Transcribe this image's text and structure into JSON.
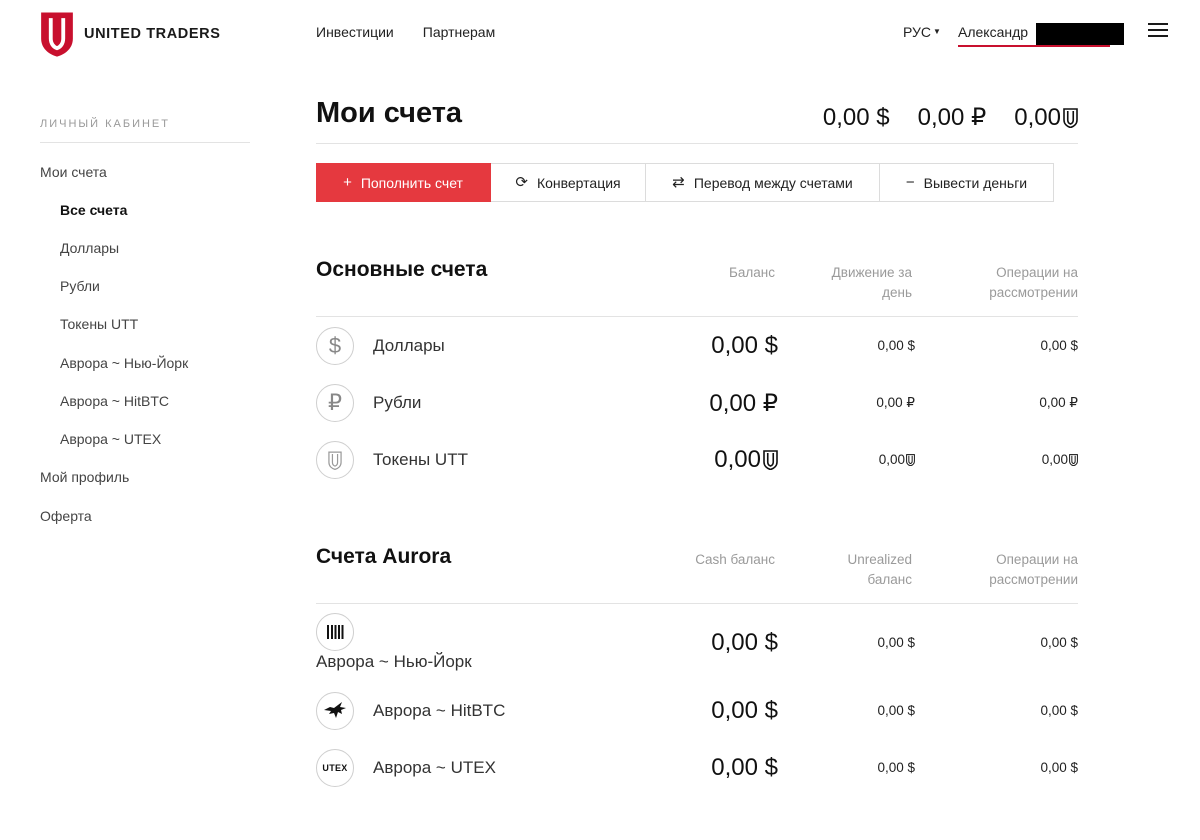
{
  "header": {
    "brand": "UNITED TRADERS",
    "nav": [
      "Инвестиции",
      "Партнерам"
    ],
    "lang": "РУС",
    "user": "Александр",
    "colors": {
      "brand_red": "#c8102e",
      "accent": "#e5393f"
    }
  },
  "sidebar": {
    "title": "ЛИЧНЫЙ КАБИНЕТ",
    "items": [
      {
        "label": "Мои счета"
      },
      {
        "label": "Все счета"
      },
      {
        "label": "Доллары"
      },
      {
        "label": "Рубли"
      },
      {
        "label": "Токены UTT"
      },
      {
        "label": "Аврора ~ Нью-Йорк"
      },
      {
        "label": "Аврора ~ HitBTC"
      },
      {
        "label": "Аврора ~ UTEX"
      },
      {
        "label": "Мой профиль"
      },
      {
        "label": "Оферта"
      }
    ]
  },
  "main": {
    "title": "Мои счета",
    "totals": {
      "usd": "0,00 $",
      "rub": "0,00 ₽",
      "utt": "0,00"
    },
    "actions": [
      {
        "label": "Пополнить счет",
        "icon": "plus-icon"
      },
      {
        "label": "Конвертация",
        "icon": "refresh-icon"
      },
      {
        "label": "Перевод между счетами",
        "icon": "swap-icon"
      },
      {
        "label": "Вывести деньги",
        "icon": "minus-icon"
      }
    ]
  },
  "main_accounts": {
    "title": "Основные счета",
    "col_balance": "Баланс",
    "col_daily_1": "Движение за",
    "col_daily_2": "день",
    "col_pending_1": "Операции на",
    "col_pending_2": "рассмотрении",
    "rows": [
      {
        "name": "Доллары",
        "icon": "dollar-icon",
        "balance": "0,00 $",
        "daily": "0,00 $",
        "pending": "0,00 $"
      },
      {
        "name": "Рубли",
        "icon": "ruble-icon",
        "balance": "0,00 ₽",
        "daily": "0,00 ₽",
        "pending": "0,00 ₽"
      },
      {
        "name": "Токены UTT",
        "icon": "utt-shield-icon",
        "balance": "0,00",
        "daily": "0,00",
        "pending": "0,00"
      }
    ]
  },
  "aurora_accounts": {
    "title": "Счета Aurora",
    "col_balance": "Cash баланс",
    "col_unreal_1": "Unrealized",
    "col_unreal_2": "баланс",
    "col_pending_1": "Операции на",
    "col_pending_2": "рассмотрении",
    "rows": [
      {
        "name": "Аврора ~ Нью-Йорк",
        "icon": "nyse-barcode-icon",
        "balance": "0,00 $",
        "unreal": "0,00 $",
        "pending": "0,00 $"
      },
      {
        "name": "Аврора ~ HitBTC",
        "icon": "hitbtc-bull-icon",
        "balance": "0,00 $",
        "unreal": "0,00 $",
        "pending": "0,00 $"
      },
      {
        "name": "Аврора ~ UTEX",
        "icon": "utex-logo-icon",
        "utex_text": "UTEX",
        "balance": "0,00 $",
        "unreal": "0,00 $",
        "pending": "0,00 $"
      }
    ]
  }
}
